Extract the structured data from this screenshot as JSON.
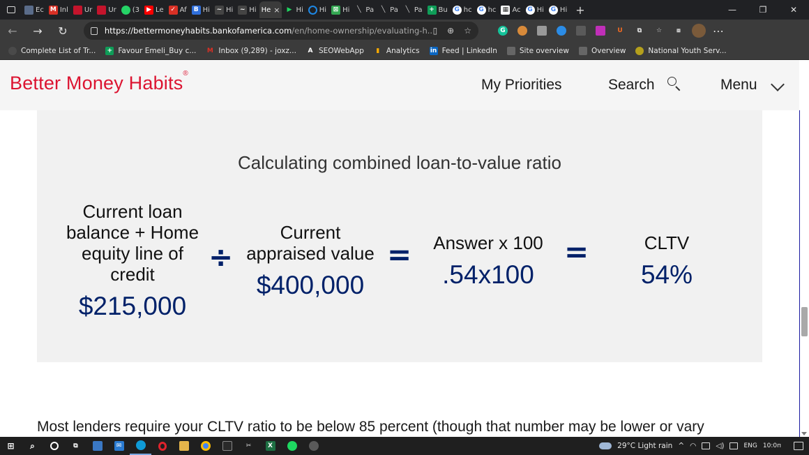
{
  "browser": {
    "tabs": [
      {
        "label": "Ec",
        "icon": "gd-icon",
        "color": "#5a6c8a"
      },
      {
        "label": "Inl",
        "icon": "gmail-icon",
        "color": "#d93025"
      },
      {
        "label": "Ur",
        "icon": "red-box-icon",
        "color": "#c4142c"
      },
      {
        "label": "Ur",
        "icon": "red-box-icon",
        "color": "#c4142c"
      },
      {
        "label": "(3",
        "icon": "whatsapp-icon",
        "color": "#25d366"
      },
      {
        "label": "Le",
        "icon": "youtube-icon",
        "color": "#ff0000"
      },
      {
        "label": "Af",
        "icon": "check-mail-icon",
        "color": "#d93025"
      },
      {
        "label": "Hi",
        "icon": "b-icon",
        "color": "#2f6fdb"
      },
      {
        "label": "Hi",
        "icon": "swoosh-icon",
        "color": "#444444"
      },
      {
        "label": "Hi",
        "icon": "swoosh-icon",
        "color": "#444444"
      }
    ],
    "active_tab": {
      "label": "He",
      "close": "×"
    },
    "tabs_after": [
      {
        "label": "Hi",
        "icon": "play-icon",
        "color": "#1ed760"
      },
      {
        "label": "Hi",
        "icon": "ring-icon",
        "color": "#1e88e5"
      },
      {
        "label": "Hi",
        "icon": "grid-icon",
        "color": "#34a853"
      },
      {
        "label": "Pa",
        "icon": "feather-icon",
        "color": "#555555"
      },
      {
        "label": "Pa",
        "icon": "feather-icon",
        "color": "#555555"
      },
      {
        "label": "Pa",
        "icon": "feather-icon",
        "color": "#555555"
      },
      {
        "label": "Bu",
        "icon": "plus-sheet-icon",
        "color": "#0f9d58"
      },
      {
        "label": "hc",
        "icon": "google-icon",
        "color": "#ffffff"
      },
      {
        "label": "hc",
        "icon": "google-icon",
        "color": "#ffffff"
      },
      {
        "label": "Ac",
        "icon": "calendar-icon",
        "color": "#ffffff"
      },
      {
        "label": "Hi",
        "icon": "google-icon",
        "color": "#ffffff"
      },
      {
        "label": "Hi",
        "icon": "google-icon",
        "color": "#ffffff"
      }
    ],
    "new_tab": "+",
    "window_controls": {
      "minimize": "—",
      "maximize": "❐",
      "close": "✕"
    },
    "url_main": "https://bettermoneyhabits.bankofamerica.com",
    "url_rest": "/en/home-ownership/evaluating-h...",
    "bookmarks": [
      {
        "label": "Complete List of Tr...",
        "icon": "bookmark-dot-icon",
        "color": "#4a4a4a"
      },
      {
        "label": "Favour Emeli_Buy c...",
        "icon": "plus-sheet-icon",
        "color": "#0f9d58"
      },
      {
        "label": "Inbox (9,289) - joxz...",
        "icon": "gmail-icon",
        "color": "#d93025"
      },
      {
        "label": "SEOWebApp",
        "icon": "a-icon",
        "color": "#3b3b3b"
      },
      {
        "label": "Analytics",
        "icon": "analytics-icon",
        "color": "#f9ab00"
      },
      {
        "label": "Feed | LinkedIn",
        "icon": "linkedin-icon",
        "color": "#0a66c2"
      },
      {
        "label": "Site overview",
        "icon": "hat-icon",
        "color": "#666666"
      },
      {
        "label": "Overview",
        "icon": "hat-icon",
        "color": "#666666"
      },
      {
        "label": "National Youth Serv...",
        "icon": "seal-icon",
        "color": "#b5a01c"
      }
    ]
  },
  "site": {
    "logo": "Better Money Habits",
    "logo_mark": "®",
    "nav_priorities": "My Priorities",
    "nav_search": "Search",
    "nav_menu": "Menu",
    "brand_color": "#dc1431",
    "value_color": "#012169"
  },
  "calc": {
    "title": "Calculating combined loan-to-value ratio",
    "col1_label": "Current loan balance + Home equity line of credit",
    "col1_value": "$215,000",
    "op_divide": "÷",
    "col2_label": "Current appraised value",
    "col2_value": "$400,000",
    "op_equals_1": "=",
    "col3_label": "Answer x 100",
    "col3_value": ".54x100",
    "op_equals_2": "=",
    "col4_label": "CLTV",
    "col4_value": "54%"
  },
  "body": {
    "text": "Most lenders require your CLTV ratio to be below 85 percent (though that number may be lower or vary"
  },
  "taskbar": {
    "weather": "29°C  Light rain",
    "lang": "ENG",
    "time": "10:0п",
    "apps": [
      {
        "icon": "windows-icon",
        "color": "#1e88e5"
      },
      {
        "icon": "search-icon",
        "color": "#1f1f1f"
      },
      {
        "icon": "circle-icon",
        "color": "#1f1f1f"
      },
      {
        "icon": "task-view-icon",
        "color": "#1f1f1f"
      },
      {
        "icon": "desktop-icon",
        "color": "#3a78c4"
      },
      {
        "icon": "mail-icon",
        "color": "#2a7bd1"
      },
      {
        "icon": "edge-icon",
        "color": "#0f9bd7"
      },
      {
        "icon": "opera-icon",
        "color": "#e0232c"
      },
      {
        "icon": "folder-icon",
        "color": "#e6b54a"
      },
      {
        "icon": "chrome-icon",
        "color": "#4285f4"
      },
      {
        "icon": "settings-icon",
        "color": "#2a2a2a"
      },
      {
        "icon": "tool-icon",
        "color": "#333333"
      },
      {
        "icon": "excel-icon",
        "color": "#1d6f42"
      },
      {
        "icon": "spotify-icon",
        "color": "#1ed760"
      },
      {
        "icon": "shield-icon",
        "color": "#5a5a5a"
      }
    ]
  }
}
